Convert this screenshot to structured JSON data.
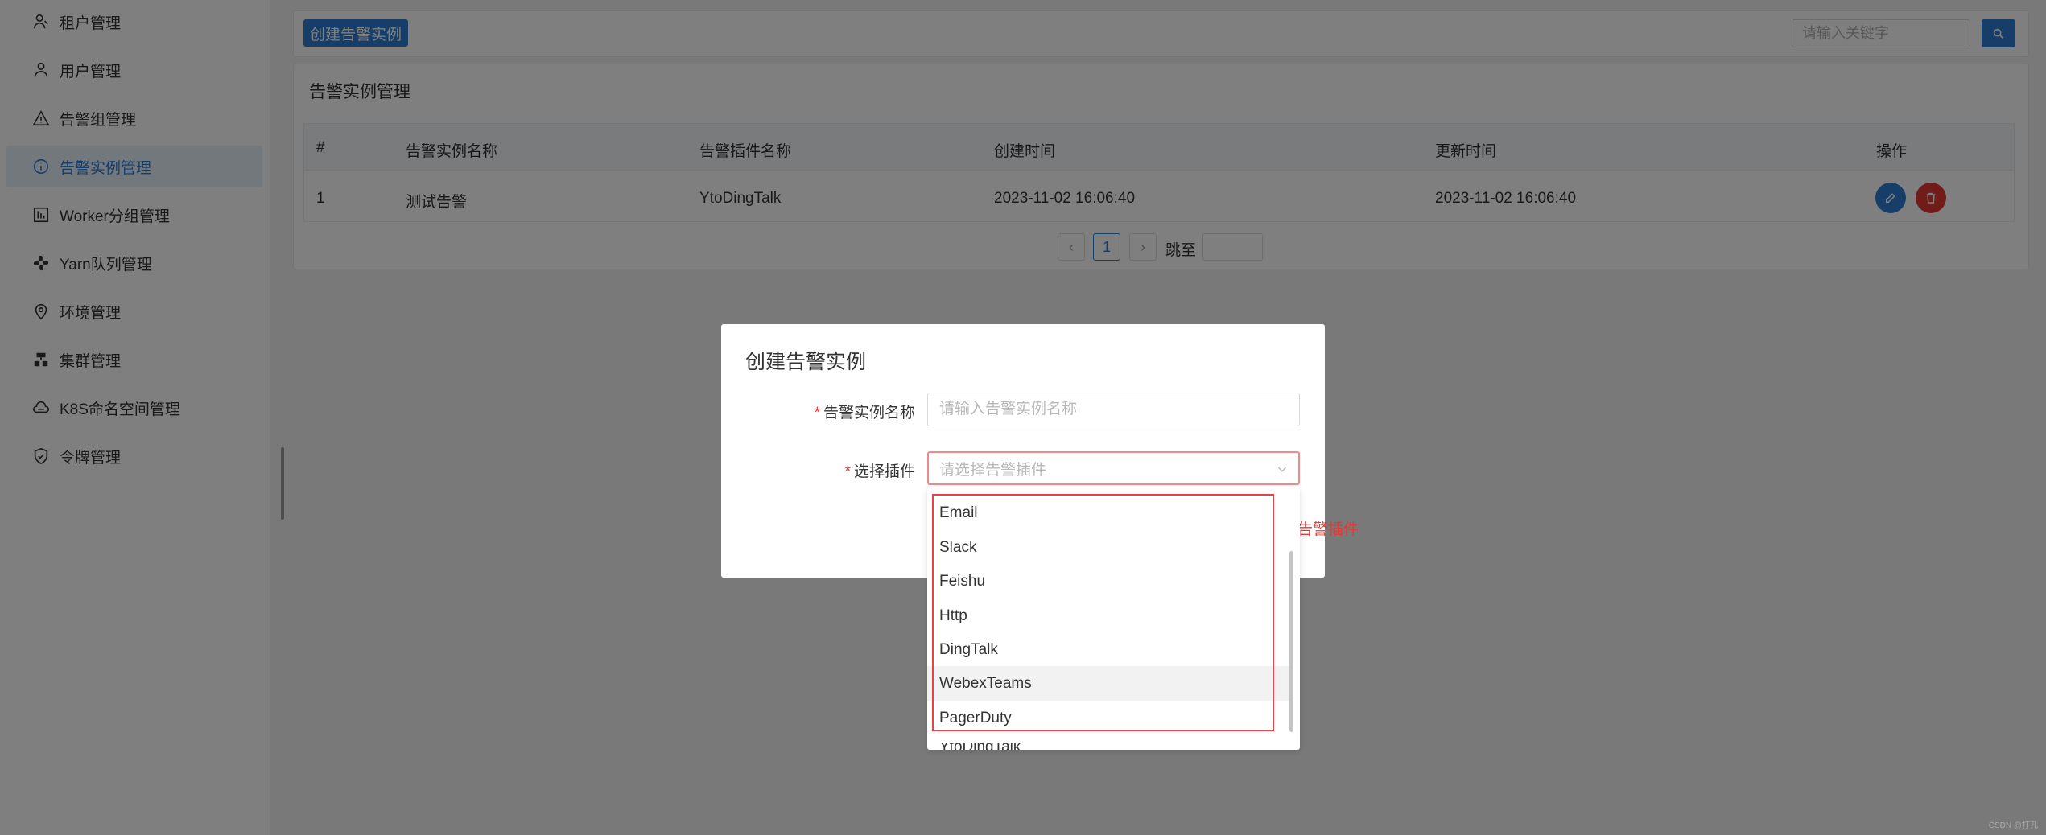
{
  "sidebar": {
    "items": [
      {
        "label": "租户管理",
        "icon": "tenant-icon"
      },
      {
        "label": "用户管理",
        "icon": "user-icon"
      },
      {
        "label": "告警组管理",
        "icon": "warning-icon"
      },
      {
        "label": "告警实例管理",
        "icon": "info-icon",
        "active": true
      },
      {
        "label": "Worker分组管理",
        "icon": "worker-group-icon"
      },
      {
        "label": "Yarn队列管理",
        "icon": "yarn-queue-icon"
      },
      {
        "label": "环境管理",
        "icon": "location-pin-icon"
      },
      {
        "label": "集群管理",
        "icon": "cluster-icon"
      },
      {
        "label": "K8S命名空间管理",
        "icon": "cloud-namespace-icon"
      },
      {
        "label": "令牌管理",
        "icon": "shield-check-icon"
      }
    ]
  },
  "toolbar": {
    "create_label": "创建告警实例",
    "search_placeholder": "请输入关键字"
  },
  "panel": {
    "title": "告警实例管理",
    "columns": [
      "#",
      "告警实例名称",
      "告警插件名称",
      "创建时间",
      "更新时间",
      "操作"
    ],
    "rows": [
      {
        "index": "1",
        "name": "测试告警",
        "plugin": "YtoDingTalk",
        "created": "2023-11-02 16:06:40",
        "updated": "2023-11-02 16:06:40"
      }
    ],
    "pagination": {
      "current_page": "1",
      "jump_label": "跳至"
    }
  },
  "dialog": {
    "title": "创建告警实例",
    "name_label": "告警实例名称",
    "name_placeholder": "请输入告警实例名称",
    "plugin_label": "选择插件",
    "plugin_placeholder": "请选择告警插件",
    "error_text": "告警插件",
    "options": [
      "Email",
      "Slack",
      "Feishu",
      "Http",
      "DingTalk",
      "WebexTeams",
      "PagerDuty",
      "YtoDingTalk"
    ],
    "hovered_option": "WebexTeams"
  },
  "colors": {
    "primary": "#2d7dd2",
    "danger": "#e53935",
    "active_menu_bg": "#e6f0fb"
  },
  "watermark": "CSDN @打孔"
}
